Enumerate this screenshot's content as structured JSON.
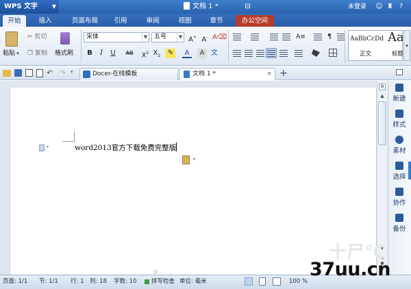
{
  "titlebar": {
    "app_name": "WPS 文字",
    "document_title": "文档 1 *",
    "login": "未登录"
  },
  "menu_tabs": [
    "开始",
    "插入",
    "页面布局",
    "引用",
    "审阅",
    "视图",
    "章节",
    "办公空间"
  ],
  "ribbon": {
    "paste": "粘贴",
    "cut": "剪切",
    "copy": "复制",
    "format_painter": "格式刷",
    "font_name": "宋体",
    "font_size": "五号",
    "style_preview_normal": "AaBbCcDd",
    "style_preview_heading": "Aa",
    "style_normal": "正文",
    "style_heading": "标题"
  },
  "doc_tabs": [
    {
      "label": "Docer-在线模板",
      "active": false
    },
    {
      "label": "文档 1 *",
      "active": true
    }
  ],
  "document": {
    "text": "word2013官方下载免费完整版"
  },
  "sidebar": [
    "新建",
    "样式",
    "素材",
    "选择",
    "协作",
    "备份"
  ],
  "status": {
    "page": "页面: 1/1",
    "section": "节: 1/1",
    "row": "行: 1",
    "column": "列: 18",
    "word_count": "字数: 10",
    "spell_check": "拼写检查",
    "unit": "单位: 毫米",
    "zoom": "100 %"
  },
  "watermark": "37uu.cn",
  "colors": {
    "title_bar": "#2f6cbb",
    "office_tab": "#b63c2c",
    "accent_blue": "#2d5b99"
  }
}
